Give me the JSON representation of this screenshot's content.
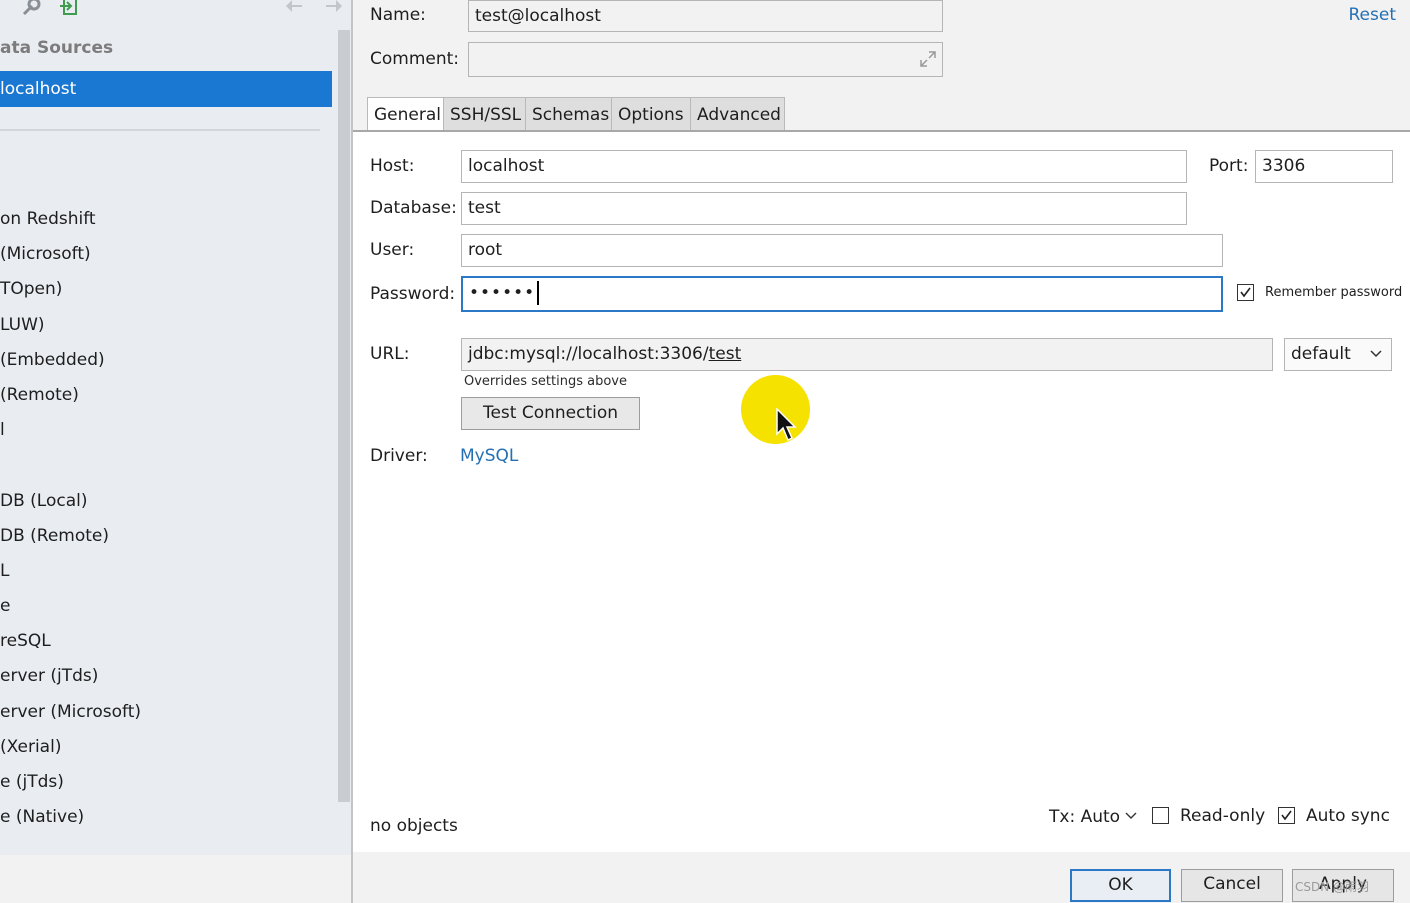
{
  "sidebar": {
    "toolbar_icons": [
      "wrench-icon",
      "import-icon",
      "back-arrow-icon",
      "forward-arrow-icon"
    ],
    "header": "ata Sources",
    "selected_item": "localhost",
    "drivers": [
      "on Redshift",
      " (Microsoft)",
      "TOpen)",
      "LUW)",
      " (Embedded)",
      " (Remote)",
      "l",
      "",
      "DB (Local)",
      "DB (Remote)",
      "L",
      "e",
      "reSQL",
      "erver (jTds)",
      "erver (Microsoft)",
      " (Xerial)",
      "e (jTds)",
      "e (Native)"
    ]
  },
  "header": {
    "name_label": "Name:",
    "name_value": "test@localhost",
    "comment_label": "Comment:",
    "comment_value": "",
    "reset": "Reset"
  },
  "tabs": [
    "General",
    "SSH/SSL",
    "Schemas",
    "Options",
    "Advanced"
  ],
  "general": {
    "host_label": "Host:",
    "host_value": "localhost",
    "port_label": "Port:",
    "port_value": "3306",
    "database_label": "Database:",
    "database_value": "test",
    "user_label": "User:",
    "user_value": "root",
    "password_label": "Password:",
    "password_value": "••••••",
    "remember_password": "Remember password",
    "url_label": "URL:",
    "url_value": "jdbc:mysql://localhost:3306/",
    "url_db": "test",
    "url_scheme": "default",
    "url_note": "Overrides settings above",
    "test_connection": "Test Connection",
    "driver_label": "Driver:",
    "driver_value": "MySQL"
  },
  "status": {
    "objects": "no objects",
    "tx": "Tx: Auto",
    "read_only": "Read-only",
    "auto_sync": "Auto sync"
  },
  "buttons": {
    "ok": "OK",
    "cancel": "Cancel",
    "apply": "Apply"
  },
  "watermark": "CSDN @雨羽",
  "colors": {
    "selection": "#1a77d2",
    "link": "#2470b3",
    "cursor_highlight": "#f6e200"
  }
}
